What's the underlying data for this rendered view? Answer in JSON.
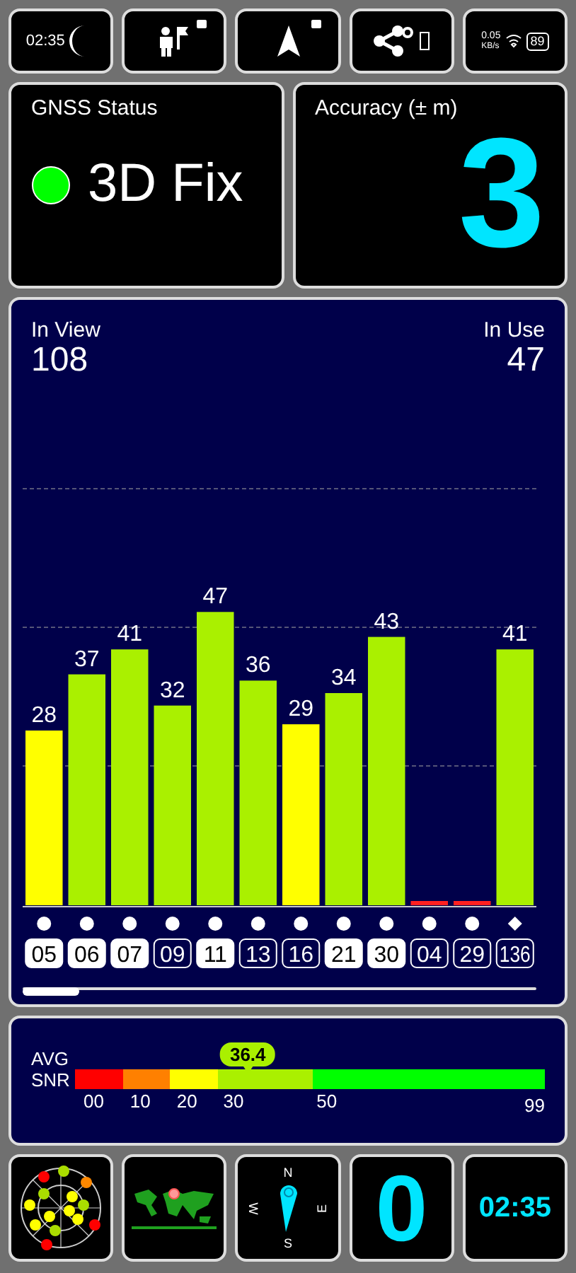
{
  "status_bar": {
    "time": "02:35",
    "speed": "0.05",
    "speed_unit": "KB/s",
    "battery": "89"
  },
  "toolbar": [
    {
      "kind": "night",
      "locked": false
    },
    {
      "kind": "pin",
      "locked": true
    },
    {
      "kind": "nav",
      "locked": true
    },
    {
      "kind": "share",
      "locked": false
    },
    {
      "kind": "more",
      "locked": false
    }
  ],
  "gnss_status": {
    "title": "GNSS Status",
    "value": "3D Fix",
    "color": "#00ff00"
  },
  "accuracy": {
    "title": "Accuracy (± m)",
    "value": "3"
  },
  "satellites_panel": {
    "in_view_label": "In View",
    "in_view": "108",
    "in_use_label": "In Use",
    "in_use": "47",
    "chart_data": {
      "type": "bar",
      "categories": [
        "05",
        "06",
        "07",
        "09",
        "11",
        "13",
        "16",
        "21",
        "30",
        "04",
        "29",
        "136"
      ],
      "values": [
        28,
        37,
        41,
        32,
        47,
        36,
        29,
        34,
        43,
        0,
        0,
        41
      ],
      "value_labels": [
        "28",
        "37",
        "41",
        "32",
        "47",
        "36",
        "29",
        "34",
        "43",
        null,
        null,
        "41"
      ]
    },
    "satellites": [
      {
        "used": true,
        "kind": "dot"
      },
      {
        "used": true,
        "kind": "dot"
      },
      {
        "used": true,
        "kind": "dot"
      },
      {
        "used": false,
        "kind": "dot"
      },
      {
        "used": true,
        "kind": "dot"
      },
      {
        "used": false,
        "kind": "dot"
      },
      {
        "used": false,
        "kind": "dot"
      },
      {
        "used": true,
        "kind": "dot"
      },
      {
        "used": true,
        "kind": "dot"
      },
      {
        "used": false,
        "kind": "dot"
      },
      {
        "used": false,
        "kind": "dot"
      },
      {
        "used": false,
        "kind": "diamond"
      }
    ]
  },
  "snr": {
    "label_1": "AVG",
    "label_2": "SNR",
    "average": "36.4",
    "level": 0.367,
    "segments": [
      {
        "label": "00",
        "color": "#ff0000"
      },
      {
        "label": "10",
        "color": "#ff8000"
      },
      {
        "label": "20",
        "color": "#ffff00"
      },
      {
        "label": "30",
        "color": "#aaf000"
      },
      {
        "label": "50",
        "color": "#00ff00"
      }
    ],
    "end_label": "99"
  },
  "bottom_tiles": [
    {
      "kind": "skyplot"
    },
    {
      "kind": "map"
    },
    {
      "kind": "compass",
      "north": "N",
      "east": "E",
      "south": "S",
      "west": "W"
    },
    {
      "kind": "big_number",
      "value": "0"
    },
    {
      "kind": "clock",
      "value": "02:35"
    }
  ]
}
